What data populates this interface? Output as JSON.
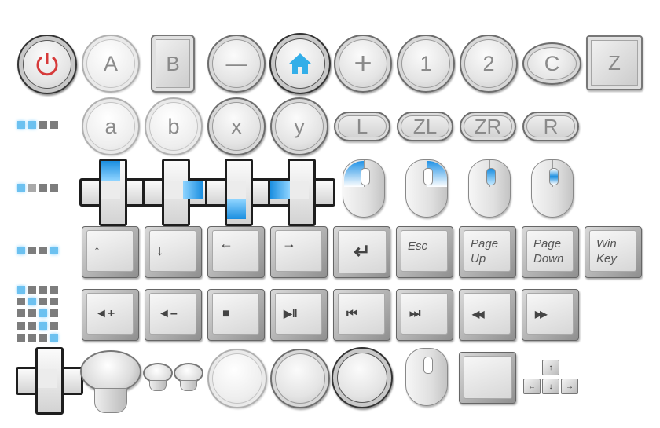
{
  "colors": {
    "highlight_blue": "#2f9fe6",
    "power_red": "#d63a3a",
    "home_blue": "#33aee8"
  },
  "row1": {
    "power": "power-icon",
    "a": "A",
    "b": "B",
    "minus": "—",
    "home": "home-icon",
    "plus": "+",
    "one": "1",
    "two": "2",
    "c": "C",
    "z": "Z"
  },
  "row2": {
    "a": "a",
    "b": "b",
    "x": "x",
    "y": "y",
    "l": "L",
    "zl": "ZL",
    "zr": "ZR",
    "r": "R"
  },
  "row4": {
    "up": "↑",
    "down": "↓",
    "left": "←",
    "right": "→",
    "enter": "↵",
    "esc": "Esc",
    "page_up_1": "Page",
    "page_up_2": "Up",
    "page_down_1": "Page",
    "page_down_2": "Down",
    "win_1": "Win",
    "win_2": "Key"
  },
  "row5": {
    "vol_up": "◄+",
    "vol_down": "◄–",
    "stop": "■",
    "play_pause": "▶‖",
    "prev": "⏮",
    "next": "⏭",
    "rewind": "◀◀",
    "forward": "▶▶"
  },
  "mini_keys": {
    "up": "↑",
    "left": "←",
    "down": "↓",
    "right": "→"
  }
}
